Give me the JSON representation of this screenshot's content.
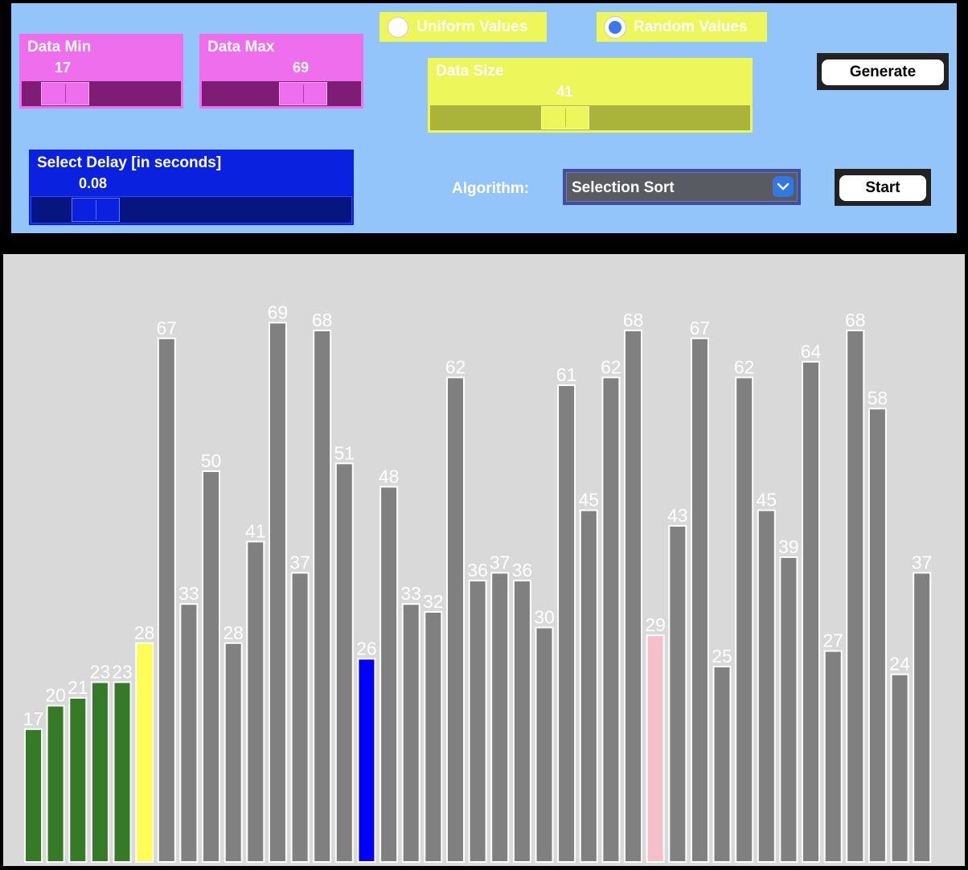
{
  "controls": {
    "data_min": {
      "label": "Data Min",
      "value": "17"
    },
    "data_max": {
      "label": "Data Max",
      "value": "69"
    },
    "radio_uniform": {
      "label": "Uniform Values",
      "checked": false
    },
    "radio_random": {
      "label": "Random Values",
      "checked": true
    },
    "data_size": {
      "label": "Data Size",
      "value": "41"
    },
    "generate_label": "Generate",
    "delay": {
      "label": "Select Delay [in seconds]",
      "value": "0.08"
    },
    "algorithm_label": "Algorithm:",
    "algorithm_value": "Selection Sort",
    "start_label": "Start"
  },
  "colors": {
    "sorted": "#357a26",
    "current_min": "#ffff55",
    "scanning": "#0000ff",
    "compare": "#f4c1cb",
    "unsorted": "#808080",
    "label": "#ffffff"
  },
  "chart_data": {
    "type": "bar",
    "values": [
      17,
      20,
      21,
      23,
      23,
      28,
      67,
      33,
      50,
      28,
      41,
      69,
      37,
      68,
      51,
      26,
      48,
      33,
      32,
      62,
      36,
      37,
      36,
      30,
      61,
      45,
      62,
      68,
      29,
      43,
      67,
      25,
      62,
      45,
      39,
      64,
      27,
      68,
      58,
      24,
      37
    ],
    "states": [
      "sorted",
      "sorted",
      "sorted",
      "sorted",
      "sorted",
      "current_min",
      "unsorted",
      "unsorted",
      "unsorted",
      "unsorted",
      "unsorted",
      "unsorted",
      "unsorted",
      "unsorted",
      "unsorted",
      "scanning",
      "unsorted",
      "unsorted",
      "unsorted",
      "unsorted",
      "unsorted",
      "unsorted",
      "unsorted",
      "unsorted",
      "unsorted",
      "unsorted",
      "unsorted",
      "unsorted",
      "compare",
      "unsorted",
      "unsorted",
      "unsorted",
      "unsorted",
      "unsorted",
      "unsorted",
      "unsorted",
      "unsorted",
      "unsorted",
      "unsorted",
      "unsorted",
      "unsorted"
    ]
  }
}
